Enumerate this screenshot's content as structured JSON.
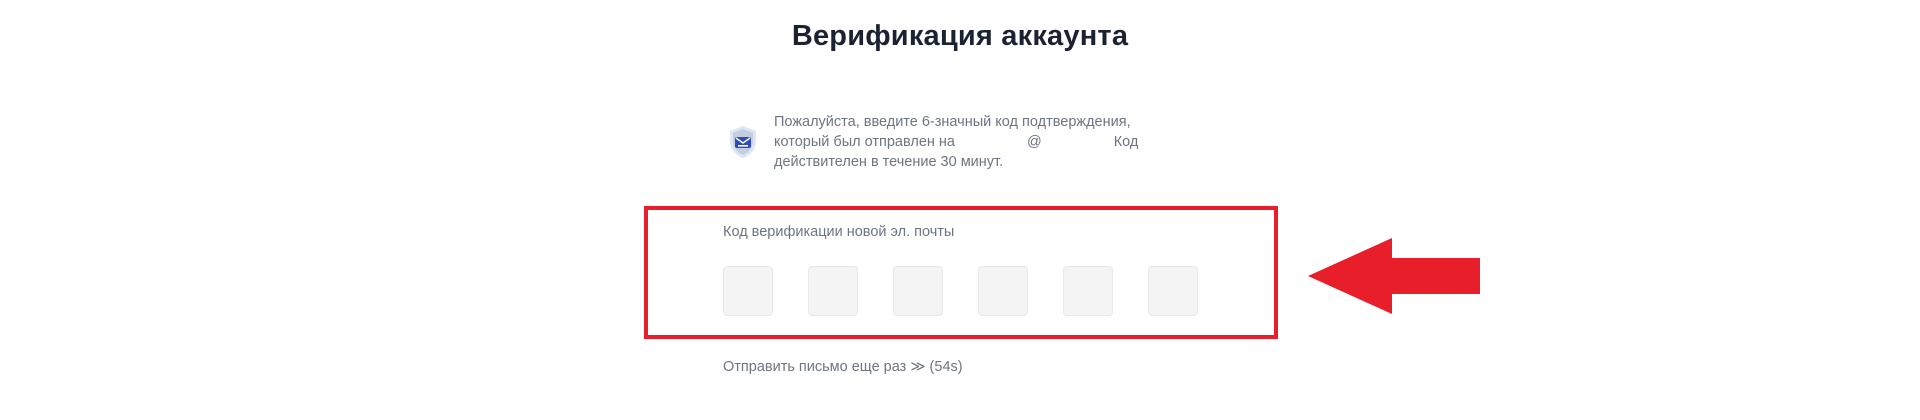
{
  "page": {
    "title": "Верификация аккаунта"
  },
  "notice": {
    "line1": "Пожалуйста, введите 6-значный код подтверждения,",
    "line2_before": "который был отправлен на",
    "line2_at": "@",
    "line2_after": "Код",
    "line3": "действителен в течение 30 минут."
  },
  "code": {
    "label": "Код верификации новой эл. почты",
    "cell_count": 6
  },
  "resend": {
    "label": "Отправить письмо еще раз",
    "chevron": "≫",
    "countdown": "(54s)"
  },
  "colors": {
    "title": "#1b2333",
    "muted_text": "#6d7582",
    "highlight": "#e81e2b",
    "cell_bg": "#f4f4f4",
    "icon_blue": "#2f4db5"
  },
  "icons": {
    "notice_icon": "shield-email-icon",
    "annotation": "arrow-left-icon"
  }
}
